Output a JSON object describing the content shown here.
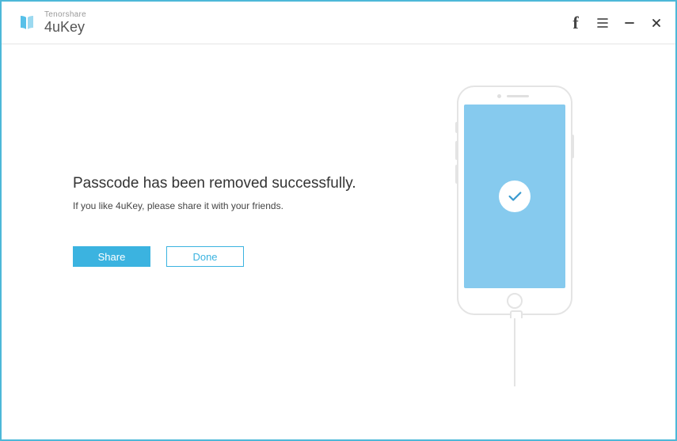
{
  "header": {
    "brand_small": "Tenorshare",
    "brand_large": "4uKey"
  },
  "main": {
    "headline": "Passcode has been removed successfully.",
    "subline": "If you like 4uKey, please share it with your friends.",
    "share_label": "Share",
    "done_label": "Done"
  }
}
